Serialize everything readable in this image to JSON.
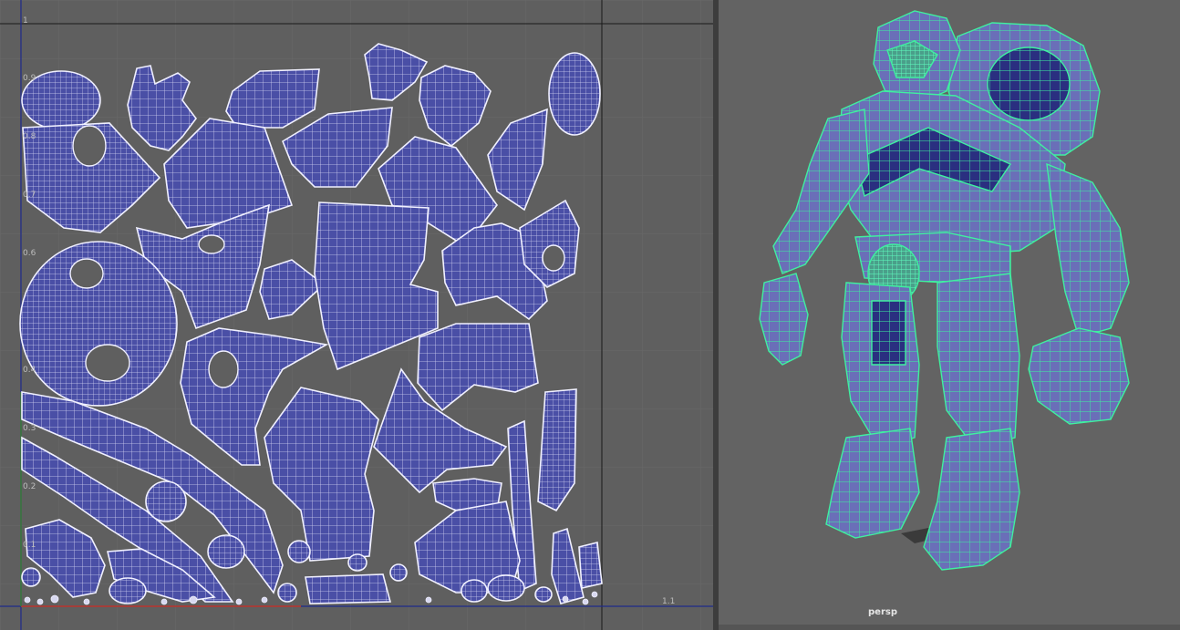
{
  "uv_editor": {
    "u_axis_ticks": [
      "1.1"
    ],
    "v_axis_ticks": [
      "1",
      "0.9",
      "0.8",
      "0.7",
      "0.6",
      "0.4",
      "0.3",
      "0.2",
      "0.1"
    ],
    "shell_fill_color": "#4a4fa6",
    "wire_color": "#e8e8ff",
    "u_axis_color": "#c0392b",
    "v_axis_color": "#3b7a3b",
    "grid_line_color": "#1a1a3a"
  },
  "viewport": {
    "camera_label": "persp",
    "wireframe_color": "#3ff0a0",
    "model_fill_color": "#6a6fb8"
  }
}
